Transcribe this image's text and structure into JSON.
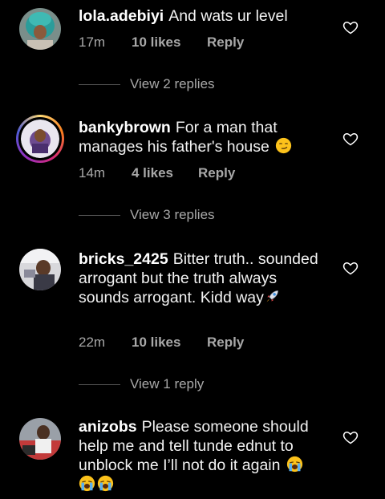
{
  "comments": [
    {
      "username": "lola.adebiyi",
      "text": "And wats ur level",
      "time": "17m",
      "likes": "10 likes",
      "reply": "Reply",
      "view_replies": "View 2 replies"
    },
    {
      "username": "bankybrown",
      "text": "For a man that manages his father's house",
      "emoji_after": "smirking-face",
      "time": "14m",
      "likes": "4 likes",
      "reply": "Reply",
      "view_replies": "View 3 replies"
    },
    {
      "username": "bricks_2425",
      "text": "Bitter truth.. sounded arrogant but the truth always sounds arrogant. Kidd way",
      "emoji_after": "rocket",
      "time": "22m",
      "likes": "10 likes",
      "reply": "Reply",
      "view_replies": "View 1 reply"
    },
    {
      "username": "anizobs",
      "text": "Please someone should help me and tell tunde ednut to unblock me I’ll not do it again",
      "emoji_after": "loudly-crying-face",
      "emoji_count": 3
    }
  ],
  "colors": {
    "background": "#000000",
    "text": "#f2f2f2",
    "secondary": "#a8a8a8",
    "divider": "#555555"
  },
  "icons": {
    "like": "heart-outline-icon"
  }
}
